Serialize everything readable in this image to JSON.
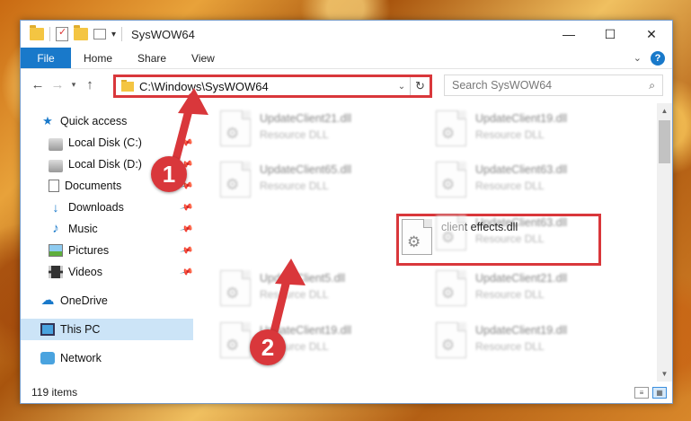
{
  "window": {
    "title": "SysWOW64",
    "caption": {
      "minimize": "—",
      "maximize": "☐",
      "close": "✕"
    }
  },
  "ribbon": {
    "tabs": [
      "File",
      "Home",
      "Share",
      "View"
    ]
  },
  "address": {
    "path": "C:\\Windows\\SysWOW64",
    "search_placeholder": "Search SysWOW64"
  },
  "nav_pane": {
    "items": [
      {
        "label": "Quick access",
        "icon": "star-icon",
        "pinned": false
      },
      {
        "label": "Local Disk (C:)",
        "icon": "drive-icon",
        "pinned": true
      },
      {
        "label": "Local Disk (D:)",
        "icon": "drive-icon",
        "pinned": true
      },
      {
        "label": "Documents",
        "icon": "documents-icon",
        "pinned": true
      },
      {
        "label": "Downloads",
        "icon": "downloads-icon",
        "pinned": true
      },
      {
        "label": "Music",
        "icon": "music-icon",
        "pinned": true
      },
      {
        "label": "Pictures",
        "icon": "pictures-icon",
        "pinned": true
      },
      {
        "label": "Videos",
        "icon": "videos-icon",
        "pinned": true
      },
      {
        "label": "OneDrive",
        "icon": "onedrive-icon",
        "pinned": false
      },
      {
        "label": "This PC",
        "icon": "this-pc-icon",
        "pinned": false,
        "selected": true
      },
      {
        "label": "Network",
        "icon": "network-icon",
        "pinned": false
      }
    ]
  },
  "files": [
    {
      "name": "UpdateClient21.dll",
      "type": "Resource DLL",
      "blurred": true
    },
    {
      "name": "UpdateClient19.dll",
      "type": "Resource DLL",
      "blurred": true
    },
    {
      "name": "UpdateClient65.dll",
      "type": "Resource DLL",
      "blurred": true
    },
    {
      "name": "UpdateClient63.dll",
      "type": "Resource DLL",
      "blurred": true
    },
    {
      "name": "client effects.dll",
      "type": "",
      "blurred": false,
      "highlighted": true
    },
    {
      "name": "UpdateClient63.dll",
      "type": "Resource DLL",
      "blurred": true
    },
    {
      "name": "UpdateClient5.dll",
      "type": "Resource DLL",
      "blurred": true
    },
    {
      "name": "UpdateClient21.dll",
      "type": "Resource DLL",
      "blurred": true
    },
    {
      "name": "UpdateClient19.dll",
      "type": "Resource DLL",
      "blurred": true
    },
    {
      "name": "UpdateClient19.dll",
      "type": "Resource DLL",
      "blurred": true
    }
  ],
  "status": {
    "item_count": "119 items"
  },
  "callouts": {
    "one": "1",
    "two": "2",
    "color": "#d9373b"
  }
}
